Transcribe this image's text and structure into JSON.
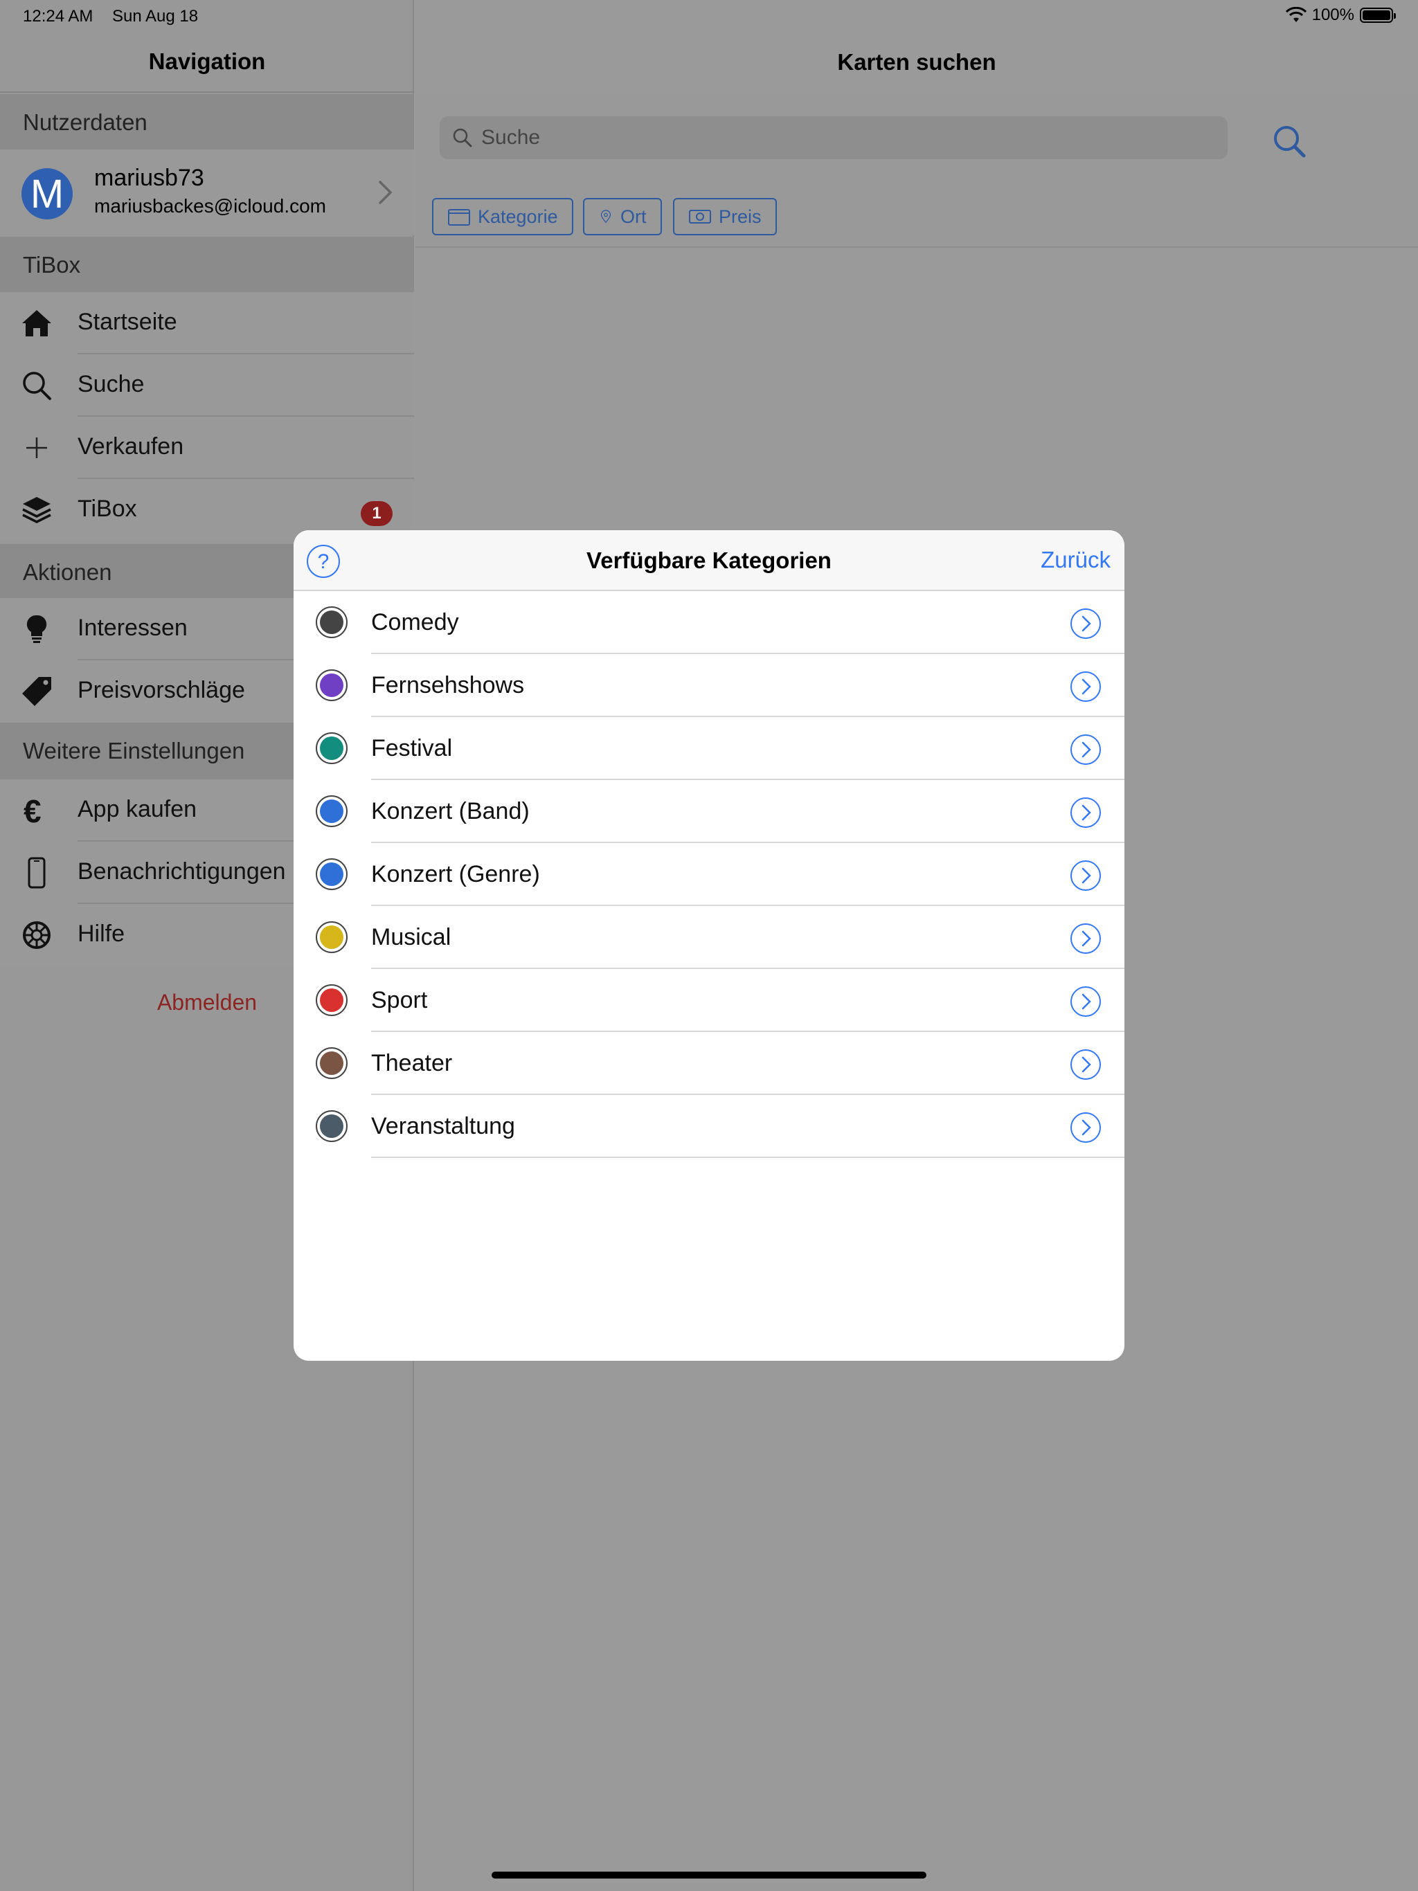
{
  "status": {
    "time": "12:24 AM",
    "date": "Sun Aug 18",
    "battery": "100%"
  },
  "sidebar": {
    "title": "Navigation",
    "sections": {
      "user": "Nutzerdaten",
      "tibox": "TiBox",
      "actions": "Aktionen",
      "settings": "Weitere Einstellungen"
    },
    "user": {
      "initial": "M",
      "name": "mariusb73",
      "email": "mariusbackes@icloud.com"
    },
    "items": [
      {
        "label": "Startseite",
        "icon": "home-icon"
      },
      {
        "label": "Suche",
        "icon": "search-icon"
      },
      {
        "label": "Verkaufen",
        "icon": "plus-icon"
      },
      {
        "label": "TiBox",
        "icon": "layers-icon",
        "badge": "1"
      },
      {
        "label": "Interessen",
        "icon": "lightbulb-icon"
      },
      {
        "label": "Preisvorschläge",
        "icon": "price-tag-icon"
      },
      {
        "label": "App kaufen",
        "icon": "euro-icon"
      },
      {
        "label": "Benachrichtigungen",
        "icon": "phone-icon"
      },
      {
        "label": "Hilfe",
        "icon": "help-wheel-icon"
      }
    ],
    "logout": "Abmelden"
  },
  "main": {
    "title": "Karten suchen",
    "search_placeholder": "Suche",
    "filters": [
      {
        "label": "Kategorie",
        "icon": "folder-icon"
      },
      {
        "label": "Ort",
        "icon": "location-pin-icon"
      },
      {
        "label": "Preis",
        "icon": "money-icon"
      }
    ]
  },
  "modal": {
    "title": "Verfügbare Kategorien",
    "back": "Zurück",
    "categories": [
      {
        "label": "Comedy",
        "color": "#444444"
      },
      {
        "label": "Fernsehshows",
        "color": "#6f3fc4"
      },
      {
        "label": "Festival",
        "color": "#138d7e"
      },
      {
        "label": "Konzert (Band)",
        "color": "#2f6fd8"
      },
      {
        "label": "Konzert (Genre)",
        "color": "#2f6fd8"
      },
      {
        "label": "Musical",
        "color": "#d6b61a"
      },
      {
        "label": "Sport",
        "color": "#d93030"
      },
      {
        "label": "Theater",
        "color": "#7a5544"
      },
      {
        "label": "Veranstaltung",
        "color": "#4b5c68"
      }
    ]
  },
  "colors": {
    "accent": "#3478f6",
    "logout": "#8c2424",
    "badge": "#8c1e1e"
  }
}
